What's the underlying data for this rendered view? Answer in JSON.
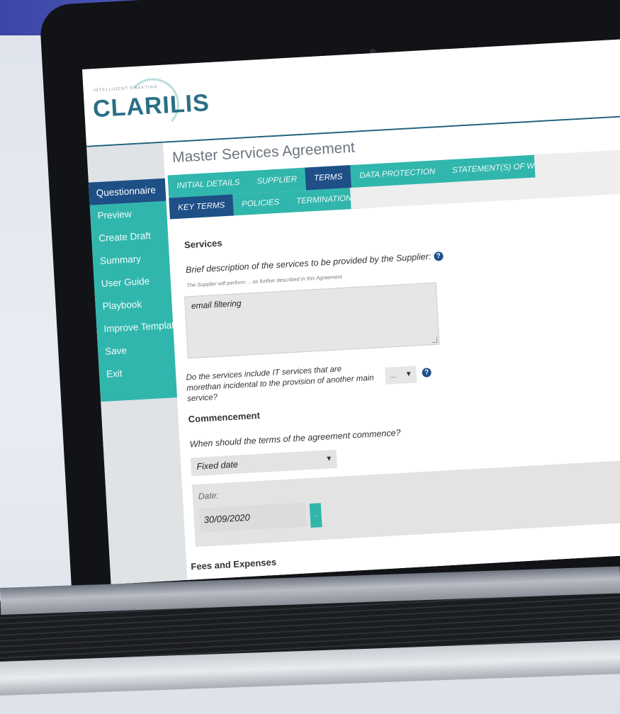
{
  "app": {
    "logo": "CLARILIS",
    "logo_tagline": "INTELLIGENT DRAFTING"
  },
  "sidebar": {
    "items": [
      {
        "label": "Questionnaire",
        "active": true
      },
      {
        "label": "Preview"
      },
      {
        "label": "Create Draft"
      },
      {
        "label": "Summary"
      },
      {
        "label": "User Guide"
      },
      {
        "label": "Playbook"
      },
      {
        "label": "Improve Template"
      },
      {
        "label": "Save"
      },
      {
        "label": "Exit"
      }
    ]
  },
  "main": {
    "title": "Master Services Agreement",
    "tabs": [
      {
        "label": "INITIAL DETAILS"
      },
      {
        "label": "SUPPLIER"
      },
      {
        "label": "TERMS",
        "active": true
      },
      {
        "label": "DATA PROTECTION"
      },
      {
        "label": "STATEMENT(S) OF WORK"
      }
    ],
    "subtabs": [
      {
        "label": "KEY TERMS",
        "active": true
      },
      {
        "label": "POLICIES"
      },
      {
        "label": "TERMINATION"
      }
    ],
    "services": {
      "heading": "Services",
      "question": "Brief description of the services to be provided by the Supplier:",
      "hint": "The Supplier will perform ... as further described in this Agreement",
      "value": "email filtering",
      "it_question": "Do the services include IT services that are morethan incidental to the provision of another main service?",
      "it_value": "..."
    },
    "commencement": {
      "heading": "Commencement",
      "question": "When should the terms of the agreement commence?",
      "selected": "Fixed date",
      "date_label": "Date:",
      "date_value": "30/09/2020",
      "date_button": "..."
    },
    "fees": {
      "heading": "Fees and Expenses"
    }
  },
  "colors": {
    "teal": "#31b6ad",
    "navy": "#1e4f87",
    "logo": "#2a6f86"
  },
  "icons": {
    "help": "question-circle-icon",
    "dropdown": "chevron-down-icon"
  }
}
